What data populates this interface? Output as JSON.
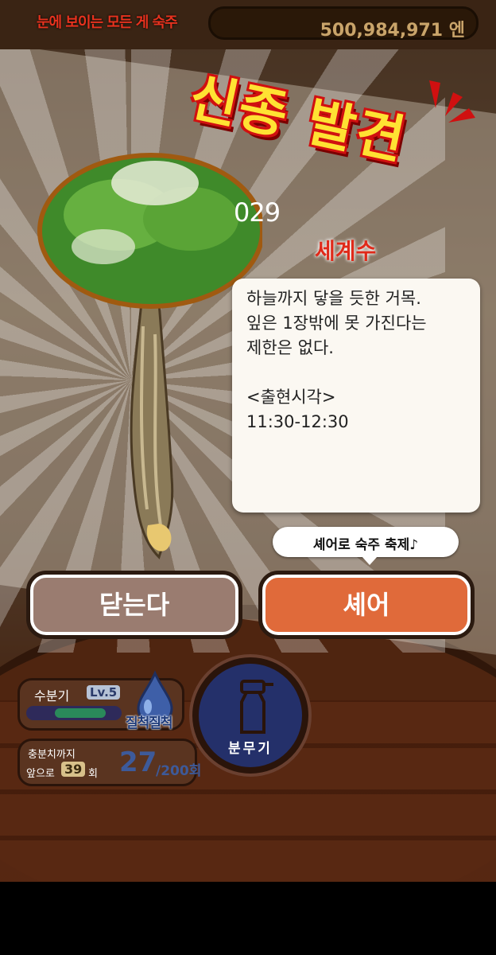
{
  "header": {
    "slogan": "눈에 보이는 모든 게 숙주",
    "money": "500,984,971 엔"
  },
  "discovery": {
    "title": "신종 발견",
    "number": "029",
    "species_name": "세계수",
    "description": "하늘까지 닿을 듯한 거목.\n잎은 1장밖에 못 가진다는\n제한은 없다.\n\n<출현시각>\n11:30-12:30"
  },
  "share_bubble": "셰어로 숙주 축제♪",
  "buttons": {
    "close_label": "닫는다",
    "share_label": "셰어"
  },
  "hud": {
    "water_label": "수분기",
    "level": "Lv.5",
    "water_status": "질척질척",
    "branch_label": "충분치까지",
    "remaining_prefix": "앞으로",
    "remaining_value": "39",
    "remaining_unit": "회",
    "count_value": "27",
    "count_total": "/200회",
    "spray_label": "분무기",
    "water_gauge_fraction": 0.55
  },
  "colors": {
    "title_fill": "#ffe233",
    "title_outline": "#d01010",
    "species": "#e02a1a",
    "close_button": "#9a7c70",
    "share_button": "#e06a3a"
  }
}
